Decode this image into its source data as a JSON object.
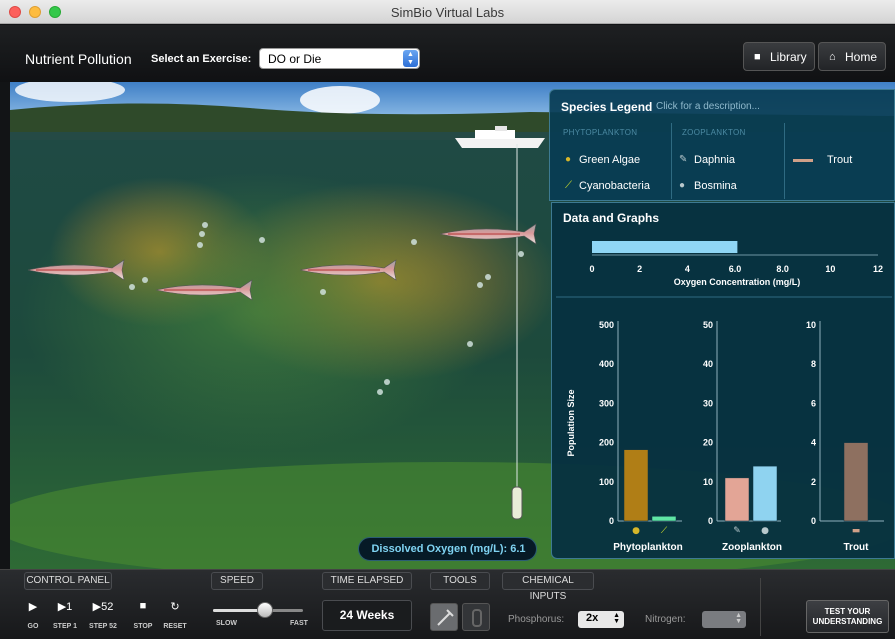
{
  "window": {
    "title": "SimBio Virtual Labs"
  },
  "header": {
    "app_title": "Nutrient Pollution",
    "exercise_label": "Select an Exercise:",
    "exercise_value": "DO or Die",
    "library_label": "Library",
    "home_label": "Home"
  },
  "legend": {
    "title": "Species Legend",
    "hint": "Click for a description...",
    "phyto_heading": "PHYTOPLANKTON",
    "zoo_heading": "ZOOPLANKTON",
    "items": {
      "green_algae": "Green Algae",
      "cyanobacteria": "Cyanobacteria",
      "daphnia": "Daphnia",
      "bosmina": "Bosmina",
      "trout": "Trout"
    }
  },
  "data_panel": {
    "title": "Data and Graphs"
  },
  "oxygen_chart": {
    "type": "bar",
    "orientation": "horizontal",
    "value": 6.1,
    "xlim": [
      0,
      12
    ],
    "ticks": [
      "0",
      "2",
      "4",
      "6.0",
      "8.0",
      "10",
      "12"
    ],
    "xlabel": "Oxygen Concentration (mg/L)",
    "color": "#8fd6f5"
  },
  "chart_data": [
    {
      "type": "bar",
      "categories": [
        "Phytoplankton"
      ],
      "series": [
        {
          "name": "Green Algae",
          "values": [
            182
          ],
          "color": "#b07e16"
        },
        {
          "name": "Cyanobacteria",
          "values": [
            12
          ],
          "color": "#5fe6a5"
        }
      ],
      "ylabel": "Population Size",
      "ylim": [
        0,
        500
      ],
      "yticks": [
        "0",
        "100",
        "200",
        "300",
        "400",
        "500"
      ]
    },
    {
      "type": "bar",
      "categories": [
        "Zooplankton"
      ],
      "series": [
        {
          "name": "Daphnia",
          "values": [
            11
          ],
          "color": "#e3a596"
        },
        {
          "name": "Bosmina",
          "values": [
            14
          ],
          "color": "#8fd3f0"
        }
      ],
      "ylim": [
        0,
        50
      ],
      "yticks": [
        "0",
        "10",
        "20",
        "30",
        "40",
        "50"
      ]
    },
    {
      "type": "bar",
      "categories": [
        "Trout"
      ],
      "series": [
        {
          "name": "Trout",
          "values": [
            4
          ],
          "color": "#8e7060"
        }
      ],
      "ylim": [
        0,
        10
      ],
      "yticks": [
        "0",
        "2",
        "4",
        "6",
        "8",
        "10"
      ]
    }
  ],
  "status": {
    "dissolved_oxygen": "Dissolved Oxygen (mg/L): 6.1"
  },
  "controls": {
    "control_panel_tab": "CONTROL PANEL",
    "speed_tab": "SPEED",
    "time_tab": "TIME ELAPSED",
    "tools_tab": "TOOLS",
    "chemical_tab": "CHEMICAL INPUTS",
    "go_label": "GO",
    "step1_label": "STEP 1",
    "step52_label": "STEP 52",
    "step52_glyph": "▶52",
    "step1_glyph": "▶1",
    "stop_label": "STOP",
    "reset_label": "RESET",
    "slow_label": "SLOW",
    "fast_label": "FAST",
    "speed_level": 0.58,
    "time_elapsed": "24 Weeks",
    "phosphorus_label": "Phosphorus:",
    "phosphorus_value": "2x",
    "nitrogen_label": "Nitrogen:",
    "test_button": "TEST YOUR UNDERSTANDING"
  }
}
